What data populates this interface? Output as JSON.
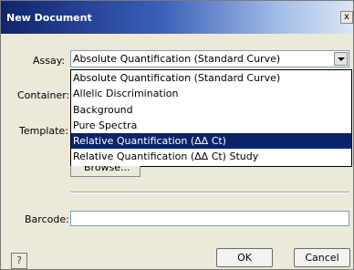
{
  "window": {
    "title": "New Document",
    "close_label": "x"
  },
  "form": {
    "assay_label": "Assay:",
    "assay_value": "Absolute Quantification (Standard Curve)",
    "container_label": "Container:",
    "template_label": "Template:",
    "barcode_label": "Barcode:",
    "barcode_value": ""
  },
  "dropdown": {
    "items": [
      "Absolute Quantification (Standard Curve)",
      "Allelic Discrimination",
      "Background",
      "Pure Spectra",
      "Relative Quantification (ΔΔ Ct)",
      "Relative Quantification (ΔΔ Ct) Study"
    ],
    "selected_index": 4
  },
  "buttons": {
    "browse": "Browse...",
    "help": "?",
    "ok": "OK",
    "cancel": "Cancel"
  }
}
